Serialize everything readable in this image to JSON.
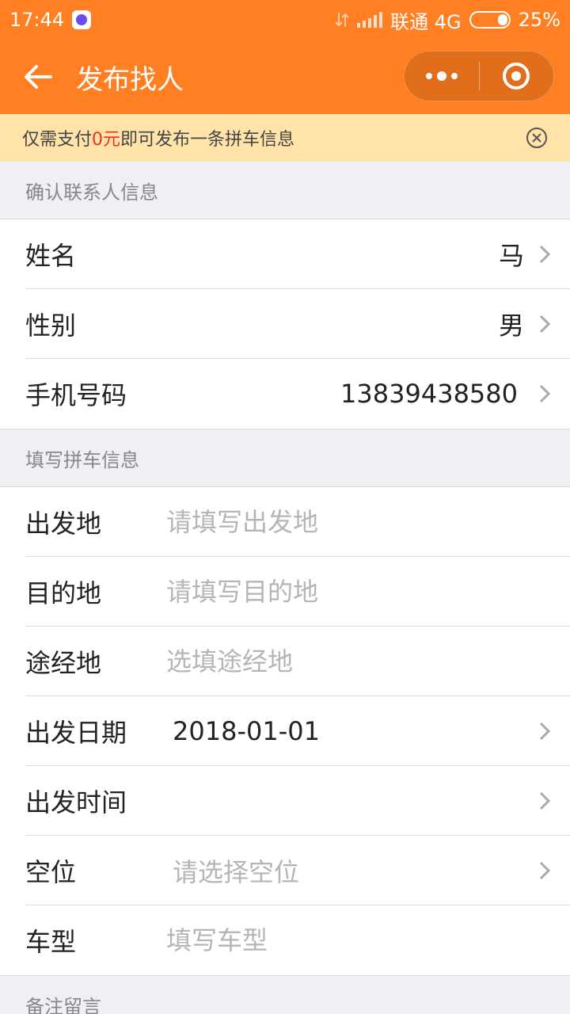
{
  "status_bar": {
    "time": "17:44",
    "carrier": "联通 4G",
    "battery": "25%"
  },
  "nav": {
    "title": "发布找人"
  },
  "notice": {
    "prefix": "仅需支付",
    "price": "0元",
    "suffix": "即可发布一条拼车信息"
  },
  "contact_section": {
    "header": "确认联系人信息",
    "rows": [
      {
        "label": "姓名",
        "value": "马"
      },
      {
        "label": "性别",
        "value": "男"
      },
      {
        "label": "手机号码",
        "value": "13839438580"
      }
    ]
  },
  "trip_section": {
    "header": "填写拼车信息",
    "origin": {
      "label": "出发地",
      "placeholder": "请填写出发地"
    },
    "destination": {
      "label": "目的地",
      "placeholder": "请填写目的地"
    },
    "via": {
      "label": "途经地",
      "placeholder": "选填途经地"
    },
    "date": {
      "label": "出发日期",
      "value": "2018-01-01"
    },
    "time": {
      "label": "出发时间",
      "value": ""
    },
    "seats": {
      "label": "空位",
      "placeholder": "请选择空位"
    },
    "car": {
      "label": "车型",
      "placeholder": "填写车型"
    }
  },
  "remarks_section": {
    "header": "备注留言"
  },
  "colors": {
    "brand_orange": "#ff7f22",
    "notice_bg": "#ffe3a9",
    "price_red": "#e8331f"
  }
}
